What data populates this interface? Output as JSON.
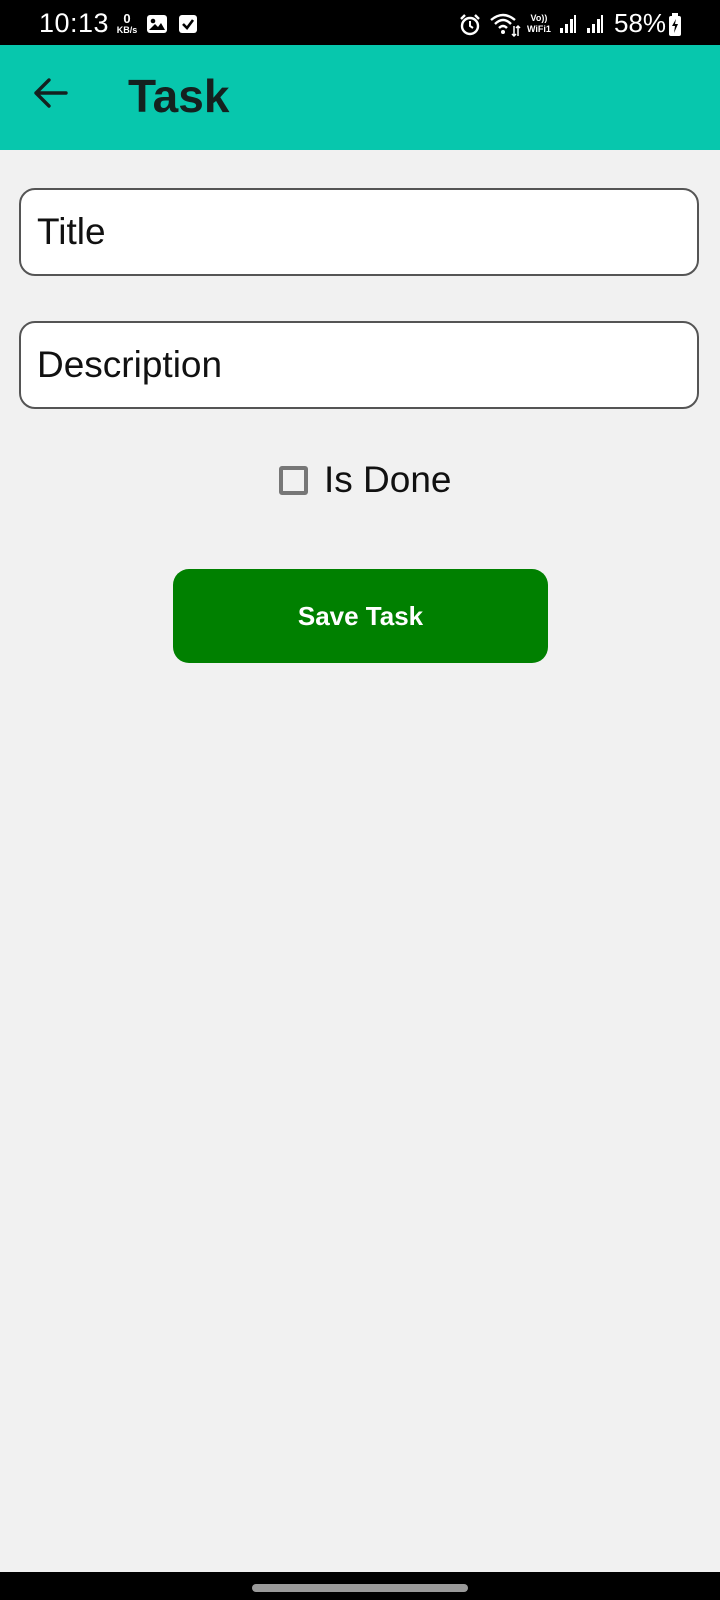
{
  "status_bar": {
    "time": "10:13",
    "net_speed_value": "0",
    "net_speed_unit": "KB/s",
    "volte_top": "Vo))",
    "volte_bottom": "WiFi1",
    "battery": "58%",
    "icons": [
      "gallery-icon",
      "check-box-icon",
      "alarm-icon",
      "wifi-icon",
      "signal-icon",
      "signal-icon",
      "battery-icon"
    ]
  },
  "app_bar": {
    "back_icon": "arrow-left-icon",
    "title": "Task",
    "background_color": "#07c7ad"
  },
  "form": {
    "title_placeholder": "Title",
    "title_value": "",
    "description_placeholder": "Description",
    "description_value": "",
    "is_done_label": "Is Done",
    "is_done_checked": false,
    "save_label": "Save Task",
    "save_color": "#008000"
  }
}
